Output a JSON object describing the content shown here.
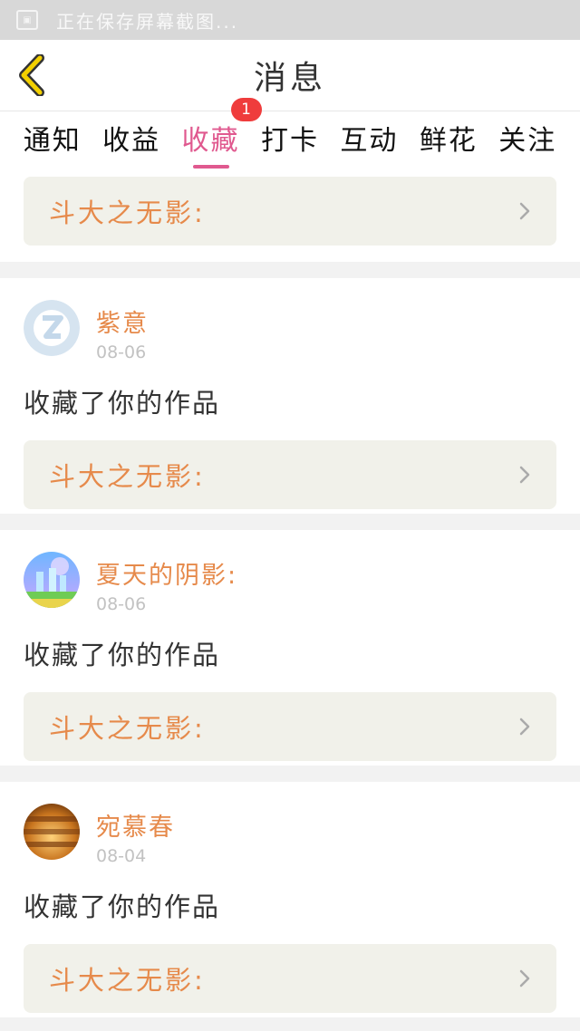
{
  "status_bar": {
    "icon_text": "▣",
    "text": "正在保存屏幕截图..."
  },
  "header": {
    "title": "消息",
    "back_icon": "chevron-left-icon"
  },
  "tabs": [
    {
      "label": "通知"
    },
    {
      "label": "收益"
    },
    {
      "label": "收藏",
      "active": true,
      "badge": "1"
    },
    {
      "label": "打卡"
    },
    {
      "label": "互动"
    },
    {
      "label": "鲜花"
    },
    {
      "label": "关注"
    }
  ],
  "first_item": {
    "work_title": "斗大之无影:"
  },
  "items": [
    {
      "username": "紫意",
      "date": "08-06",
      "action": "收藏了你的作品",
      "work_title": "斗大之无影:"
    },
    {
      "username": "夏天的阴影:",
      "date": "08-06",
      "action": "收藏了你的作品",
      "work_title": "斗大之无影:"
    },
    {
      "username": "宛慕春",
      "date": "08-04",
      "action": "收藏了你的作品",
      "work_title": "斗大之无影:"
    }
  ],
  "colors": {
    "accent_pink": "#e0598f",
    "username_orange": "#e68a4b",
    "badge_red": "#ef3c3c",
    "back_yellow": "#f3d000"
  }
}
